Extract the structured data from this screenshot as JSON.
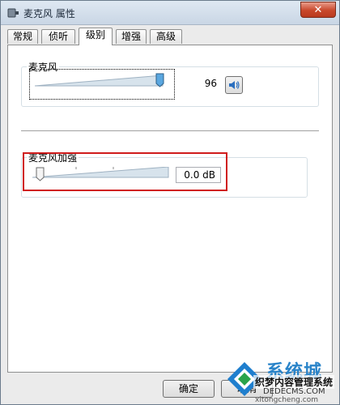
{
  "window": {
    "title": "麦克风 属性",
    "close_glyph": "✕"
  },
  "tabs": [
    {
      "label": "常规",
      "active": false
    },
    {
      "label": "侦听",
      "active": false
    },
    {
      "label": "级别",
      "active": true
    },
    {
      "label": "增强",
      "active": false
    },
    {
      "label": "高级",
      "active": false
    }
  ],
  "microphone": {
    "label": "麦克风",
    "value_text": "96",
    "level": 96,
    "speaker_icon": "speaker-icon"
  },
  "boost": {
    "label": "麦克风加强",
    "value_text": "0.0 dB",
    "level": 0
  },
  "buttons": {
    "ok_label": "确定",
    "cancel_label": "取消"
  },
  "watermark": {
    "big": "系统城",
    "mid": "织梦内容管理系统",
    "url1": "DEDECMS.COM",
    "url2": "xitongcheng.com"
  },
  "colors": {
    "highlight": "#d01c1c",
    "thumb_blue": "#5aa7e0"
  }
}
